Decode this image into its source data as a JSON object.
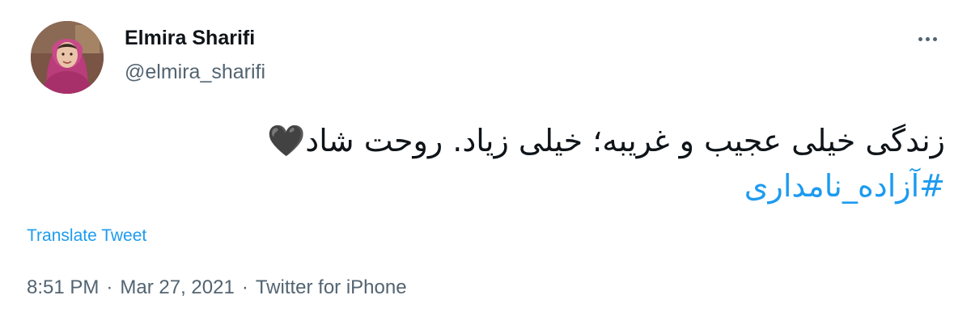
{
  "tweet": {
    "author": {
      "display_name": "Elmira Sharifi",
      "handle": "@elmira_sharifi"
    },
    "text": "زندگی خیلی عجیب و غریبه؛ خیلی زیاد. روحت شاد",
    "emoji": "🖤",
    "hashtag": "#آزاده_نامداری",
    "translate_label": "Translate Tweet",
    "time": "8:51 PM",
    "separator": "·",
    "date": "Mar 27, 2021",
    "source": "Twitter for iPhone"
  },
  "icons": {
    "more": "more-horizontal-icon",
    "heart": "black-heart-icon"
  },
  "colors": {
    "link": "#1d9bf0",
    "secondary_text": "#536471",
    "primary_text": "#0f1419"
  }
}
